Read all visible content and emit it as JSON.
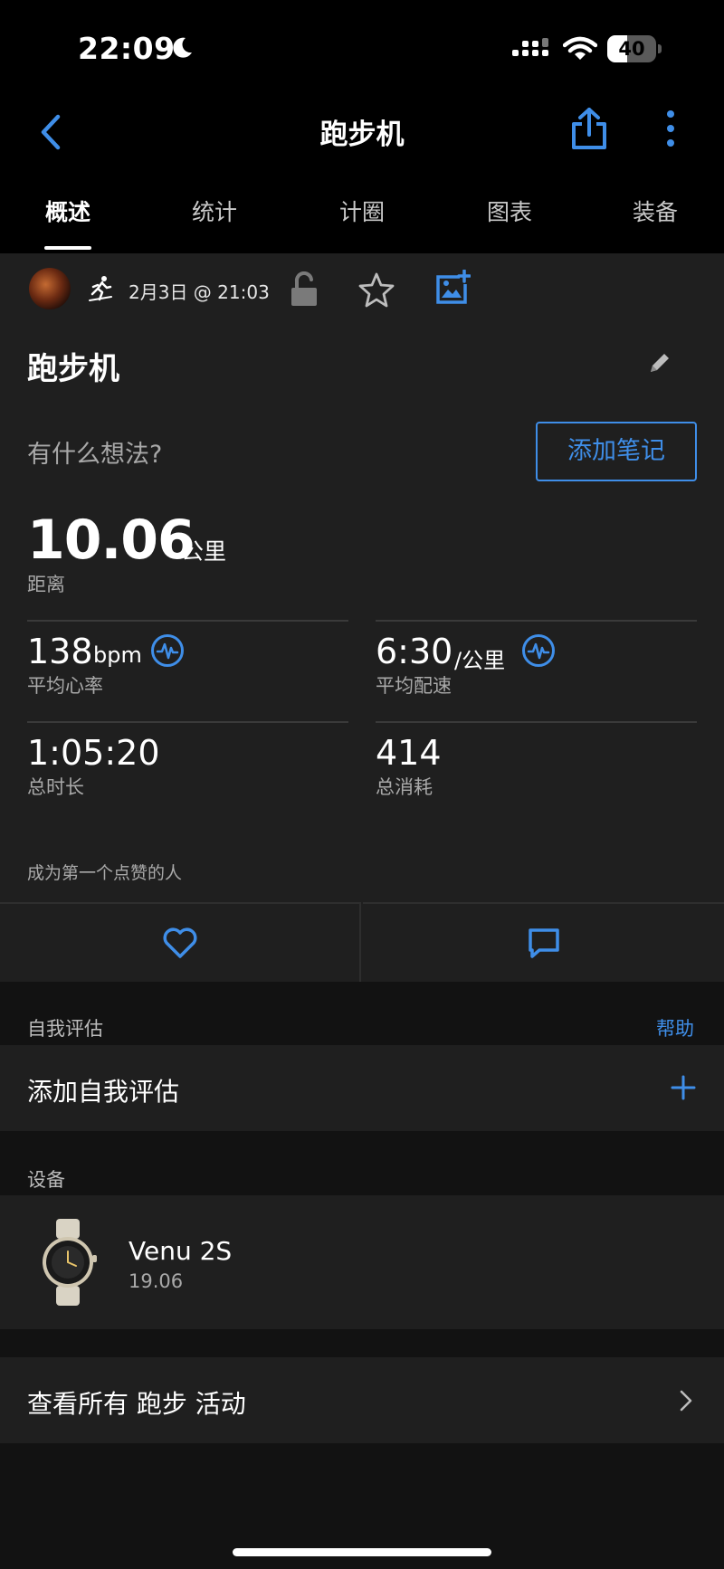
{
  "status_bar": {
    "time": "22:09",
    "battery_level": "40",
    "battery_fraction": 0.4
  },
  "nav": {
    "title": "跑步机"
  },
  "tabs": [
    {
      "label": "概述",
      "active": true
    },
    {
      "label": "统计"
    },
    {
      "label": "计圈"
    },
    {
      "label": "图表"
    },
    {
      "label": "装备"
    }
  ],
  "activity": {
    "datetime": "2月3日 @ 21:03",
    "title": "跑步机",
    "thoughts_prompt": "有什么想法?",
    "add_note_label": "添加笔记",
    "distance": {
      "value": "10.06",
      "unit": "公里",
      "label": "距离"
    },
    "stats": {
      "heart_rate": {
        "value": "138",
        "unit": "bpm",
        "label": "平均心率"
      },
      "pace": {
        "value": "6:30",
        "unit": "/公里",
        "label": "平均配速"
      },
      "duration": {
        "value": "1:05:20",
        "label": "总时长"
      },
      "calories": {
        "value": "414",
        "label": "总消耗"
      }
    },
    "like_prompt": "成为第一个点赞的人"
  },
  "self_evaluation": {
    "header": "自我评估",
    "help_label": "帮助",
    "add_label": "添加自我评估"
  },
  "device": {
    "header": "设备",
    "name": "Venu 2S",
    "version": "19.06"
  },
  "view_all": {
    "label": "查看所有 跑步 活动"
  },
  "colors": {
    "accent": "#3f8ee8",
    "card": "#1f1f1f",
    "background": "#121212"
  }
}
